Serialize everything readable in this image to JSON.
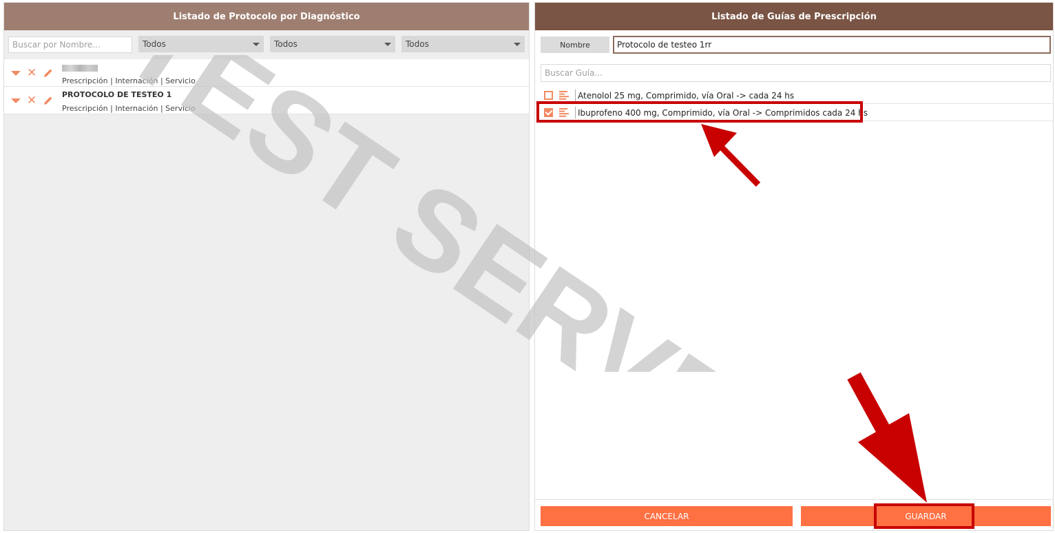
{
  "left_panel": {
    "title": "Listado de Protocolo por Diagnóstico",
    "search_placeholder": "Buscar por Nombre...",
    "filters": [
      "Todos",
      "Todos",
      "Todos"
    ],
    "protocols": [
      {
        "name": "",
        "subtitle": "Prescripción | Internación | Servicio"
      },
      {
        "name": "PROTOCOLO DE TESTEO 1",
        "subtitle": "Prescripción | Internación | Servicio"
      }
    ]
  },
  "right_panel": {
    "title": "Listado de Guías de Prescripción",
    "name_label": "Nombre",
    "name_value": "Protocolo de testeo 1rr",
    "guide_search_placeholder": "Buscar Guía...",
    "guides": [
      {
        "text": "Atenolol 25 mg, Comprimido, vía Oral ->  cada 24 hs",
        "checked": false
      },
      {
        "text": "Ibuprofeno 400 mg, Comprimido, vía Oral -> Comprimidos cada 24 hs",
        "checked": true
      }
    ],
    "cancel_label": "CANCELAR",
    "save_label": "GUARDAR"
  },
  "watermark": "TEST SERVER",
  "colors": {
    "left_header": "#9e7e70",
    "right_header": "#7a5444",
    "accent": "#ff7043",
    "icon": "#f08a62",
    "annotation": "#c80000"
  }
}
